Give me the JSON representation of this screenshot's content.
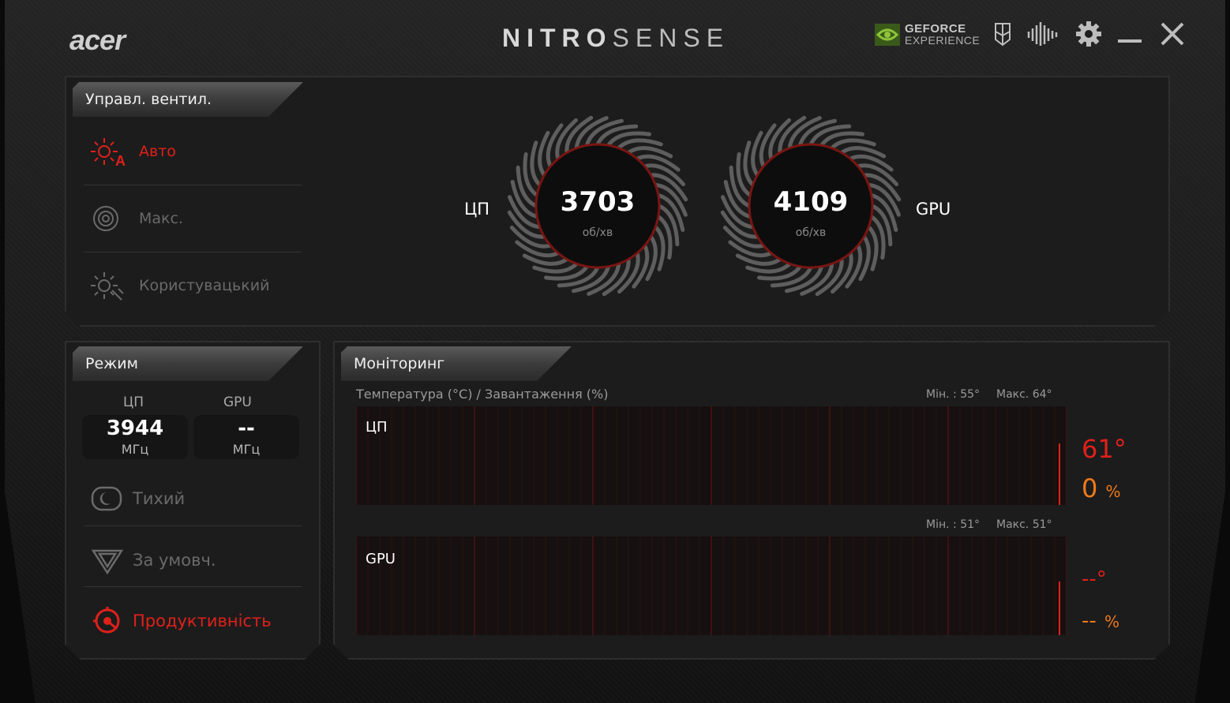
{
  "app": {
    "logo": "acer",
    "title_bold": "NITRO",
    "title_light": "SENSE",
    "top_icons": [
      "geforce-experience-icon",
      "keyboard-lighting-icon",
      "audio-icon",
      "settings-gear-icon",
      "minimize-icon",
      "close-icon"
    ],
    "geforce_line1": "GEFORCE",
    "geforce_line2": "EXPERIENCE"
  },
  "fan_control": {
    "title": "Управл. вентил.",
    "options": [
      {
        "label": "Авто",
        "active": true,
        "icon": "fan-auto-icon"
      },
      {
        "label": "Макс.",
        "active": false,
        "icon": "fan-max-icon"
      },
      {
        "label": "Користувацький",
        "active": false,
        "icon": "fan-custom-icon"
      }
    ],
    "cpu": {
      "label": "ЦП",
      "rpm": "3703",
      "unit": "об/хв"
    },
    "gpu": {
      "label": "GPU",
      "rpm": "4109",
      "unit": "об/хв"
    }
  },
  "mode": {
    "title": "Режим",
    "cpu_label": "ЦП",
    "gpu_label": "GPU",
    "cpu_freq": "3944",
    "gpu_freq": "--",
    "freq_unit": "МГц",
    "options": [
      {
        "label": "Тихий",
        "active": false,
        "icon": "quiet-mode-icon"
      },
      {
        "label": "За умовч.",
        "active": false,
        "icon": "default-mode-icon"
      },
      {
        "label": "Продуктивність",
        "active": true,
        "icon": "performance-mode-icon"
      }
    ]
  },
  "monitoring": {
    "title": "Моніторинг",
    "header": "Температура (°C) / Завантаження (%)",
    "cpu": {
      "label": "ЦП",
      "min": "Мін. :  55°",
      "max": "Макс. 64°",
      "temp": "61°",
      "load": "0",
      "load_unit": "%"
    },
    "gpu": {
      "label": "GPU",
      "min": "Мін. :  51°",
      "max": "Макс. 51°",
      "temp": "--°",
      "load": "--",
      "load_unit": "%"
    }
  },
  "colors": {
    "accent_red": "#e0201a",
    "load_orange": "#f07a1a",
    "text": "#ffffff",
    "muted": "#6a6a6a"
  }
}
